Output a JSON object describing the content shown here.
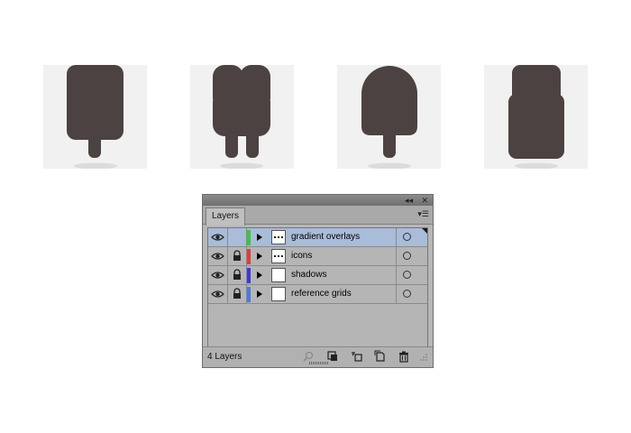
{
  "artboards": {
    "icons": [
      {
        "name": "popsicle-icon-1"
      },
      {
        "name": "popsicle-icon-2"
      },
      {
        "name": "popsicle-icon-3"
      },
      {
        "name": "popsicle-icon-4"
      }
    ],
    "colors": {
      "tile": "#f1f1f1",
      "shape": "#4d4242",
      "shadow": "#dcdcdc"
    }
  },
  "layers_panel": {
    "tab_label": "Layers",
    "collapse_glyph": "◂◂",
    "close_glyph": "✕",
    "menu_glyph": "▾☰",
    "layers": [
      {
        "name": "gradient overlays",
        "color": "#3ec43e",
        "locked": false,
        "selected": true,
        "thumb_dotted": true
      },
      {
        "name": "icons",
        "color": "#e03c3c",
        "locked": true,
        "selected": false,
        "thumb_dotted": true
      },
      {
        "name": "shadows",
        "color": "#3b3bd6",
        "locked": true,
        "selected": false,
        "thumb_dotted": false
      },
      {
        "name": "reference grids",
        "color": "#4a7ae0",
        "locked": true,
        "selected": false,
        "thumb_dotted": false
      }
    ],
    "footer": {
      "count_label": "4 Layers"
    }
  }
}
